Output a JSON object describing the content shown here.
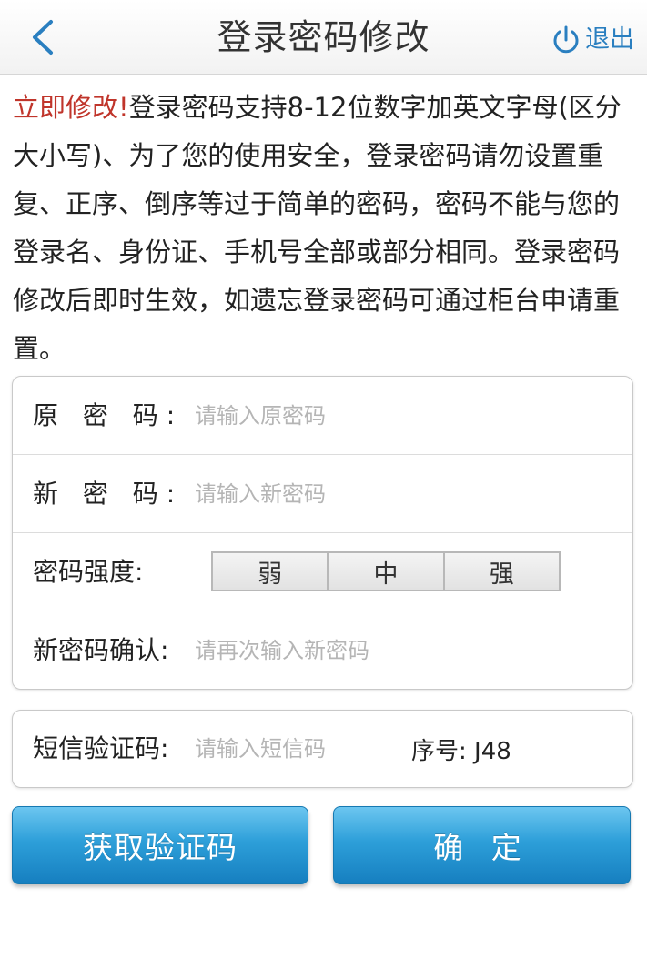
{
  "header": {
    "title": "登录密码修改",
    "logout_label": "退出"
  },
  "notice": {
    "highlight": "立即修改!",
    "text": "登录密码支持8-12位数字加英文字母(区分大小写)、为了您的使用安全，登录密码请勿设置重复、正序、倒序等过于简单的密码，密码不能与您的登录名、身份证、手机号全部或部分相同。登录密码修改后即时生效，如遗忘登录密码可通过柜台申请重置。"
  },
  "form": {
    "old_password": {
      "label": "原 密 码:",
      "placeholder": "请输入原密码"
    },
    "new_password": {
      "label": "新 密 码:",
      "placeholder": "请输入新密码"
    },
    "strength": {
      "label": "密码强度:",
      "levels": [
        "弱",
        "中",
        "强"
      ]
    },
    "confirm_password": {
      "label": "新密码确认:",
      "placeholder": "请再次输入新密码"
    }
  },
  "sms": {
    "label": "短信验证码:",
    "placeholder": "请输入短信码",
    "serial": "序号: J48"
  },
  "buttons": {
    "get_code": "获取验证码",
    "confirm": "确 定"
  },
  "colors": {
    "accent": "#2a7fc0",
    "warning": "#c0352b",
    "button_top": "#6cc6f0",
    "button_bottom": "#167fc0"
  }
}
